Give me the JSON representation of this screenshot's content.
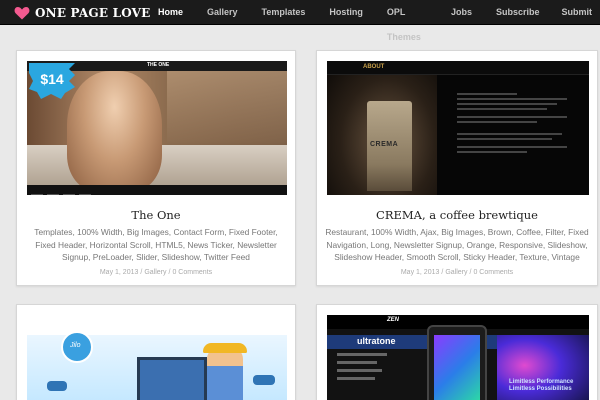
{
  "brand": {
    "name": "ONE PAGE LOVE",
    "color": "#f45a90"
  },
  "nav": [
    {
      "label": "Home",
      "active": true
    },
    {
      "label": "Gallery"
    },
    {
      "label": "Templates"
    },
    {
      "label": "Hosting"
    },
    {
      "label": "OPL Themes"
    },
    {
      "label": "Jobs"
    },
    {
      "label": "Subscribe"
    },
    {
      "label": "Submit"
    }
  ],
  "cards": [
    {
      "title": "The One",
      "price": "$14",
      "thumb_label": "THE ONE",
      "tags": "Templates, 100% Width, Big Images, Contact Form, Fixed Footer, Fixed Header, Horizontal Scroll, HTML5, News Ticker, Newsletter Signup, PreLoader, Slider, Slideshow, Twitter Feed",
      "date": "May 1, 2013",
      "category": "Gallery",
      "comments": "0 Comments"
    },
    {
      "title": "CREMA, a coffee brewtique",
      "thumb_label": "ABOUT",
      "thumb_product": "CREMA",
      "tags": "Restaurant, 100% Width, Ajax, Big Images, Brown, Coffee, Filter, Fixed Navigation, Long, Newsletter Signup, Orange, Responsive, Slideshow, Slideshow Header, Smooth Scroll, Sticky Header, Texture, Vintage",
      "date": "May 1, 2013",
      "category": "Gallery",
      "comments": "0 Comments"
    },
    {
      "thumb_badge": "Jilo"
    },
    {
      "thumb_brand": "ZEN",
      "thumb_product": "ultratone",
      "thumb_tagline": "Limitless Performance Limitless Possibilities"
    }
  ],
  "colors": {
    "nav_bg": "#1b1b1b",
    "page_bg": "#e9e9e9",
    "price_badge": "#2aa7e0"
  }
}
